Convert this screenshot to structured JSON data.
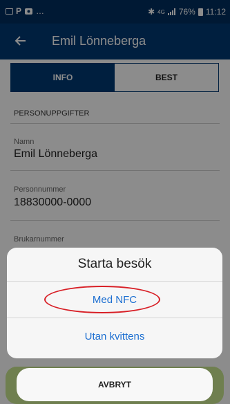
{
  "status_bar": {
    "battery_percent": "76%",
    "time": "11:12",
    "network": "4G"
  },
  "app_bar": {
    "title": "Emil Lönneberga"
  },
  "tabs": [
    {
      "label": "INFO",
      "selected": true
    },
    {
      "label": "BEST",
      "selected": false
    }
  ],
  "section": {
    "header": "PERSONUPPGIFTER",
    "fields": [
      {
        "label": "Namn",
        "value": "Emil Lönneberga"
      },
      {
        "label": "Personnummer",
        "value": "18830000-0000"
      },
      {
        "label": "Brukarnummer",
        "value": ""
      }
    ]
  },
  "action_sheet": {
    "title": "Starta besök",
    "options": [
      "Med NFC",
      "Utan kvittens"
    ],
    "cancel_label": "AVBRYT"
  },
  "colors": {
    "app_bar": "#003a73",
    "status_bar": "#002f5f",
    "link": "#1d6fd1",
    "highlight": "#d81f26"
  }
}
